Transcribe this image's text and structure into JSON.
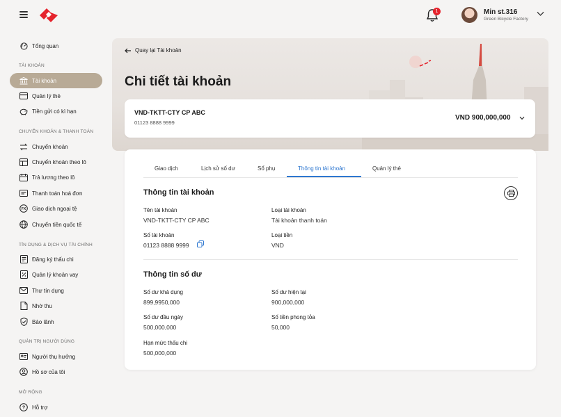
{
  "header": {
    "user_name": "Min st.316",
    "user_company": "Green Bicycle Factory",
    "notification_count": "1"
  },
  "sidebar": {
    "overview": "Tổng quan",
    "sections": {
      "accounts": "TÀI KHOẢN",
      "transfer": "CHUYỂN KHOẢN & THANH TOÁN",
      "credit": "TÍN DỤNG & DỊCH VỤ TÀI CHÍNH",
      "admin": "QUẢN TRỊ NGƯỜI DÙNG",
      "more": "MỞ RỘNG"
    },
    "items": {
      "accounts": "Tài khoản",
      "cards": "Quản lý thẻ",
      "deposits": "Tiền gửi có kì hạn",
      "transfer": "Chuyển khoản",
      "batch_transfer": "Chuyển khoản theo lô",
      "payroll": "Trả lương theo lô",
      "bill_payment": "Thanh toán hoá đơn",
      "fx": "Giao dịch ngoại tệ",
      "intl_transfer": "Chuyển tiền quốc tế",
      "overdraft": "Đăng ký thấu chi",
      "loans": "Quản lý khoản vay",
      "letter_of_credit": "Thư tín dụng",
      "collection": "Nhờ thu",
      "guarantee": "Bảo lãnh",
      "beneficiaries": "Người thụ hưởng",
      "my_profile": "Hồ sơ của tôi",
      "support": "Hỗ trợ"
    }
  },
  "page": {
    "back_label": "Quay lại Tài khoản",
    "title": "Chi tiết tài khoản"
  },
  "account": {
    "name": "VND-TKTT-CTY CP ABC",
    "number": "01123 8888 9999",
    "balance": "VND 900,000,000"
  },
  "tabs": [
    "Giao dịch",
    "Lịch sử số dư",
    "Sổ phụ",
    "Thông tin tài khoản",
    "Quản lý thẻ"
  ],
  "active_tab": "Thông tin tài khoản",
  "account_info": {
    "title": "Thông tin tài khoản",
    "name_label": "Tên tài khoản",
    "name_value": "VND-TKTT-CTY CP ABC",
    "type_label": "Loại tài khoản",
    "type_value": "Tài khoản thanh toán",
    "number_label": "Số tài khoản",
    "number_value": "01123 8888 9999",
    "currency_label": "Loại tiền",
    "currency_value": "VND"
  },
  "balance_info": {
    "title": "Thông tin số dư",
    "available_label": "Số dư khả dụng",
    "available_value": "899,9950,000",
    "current_label": "Số dư hiện tại",
    "current_value": "900,000,000",
    "opening_label": "Số dư đầu ngày",
    "opening_value": "500,000,000",
    "blocked_label": "Số tiền phong tỏa",
    "blocked_value": "50,000",
    "overdraft_label": "Hạn mức thấu chi",
    "overdraft_value": "500,000,000"
  },
  "colors": {
    "brand_red": "#e5232c",
    "active_nav": "#b8aa96",
    "tab_accent": "#2e77d0"
  }
}
